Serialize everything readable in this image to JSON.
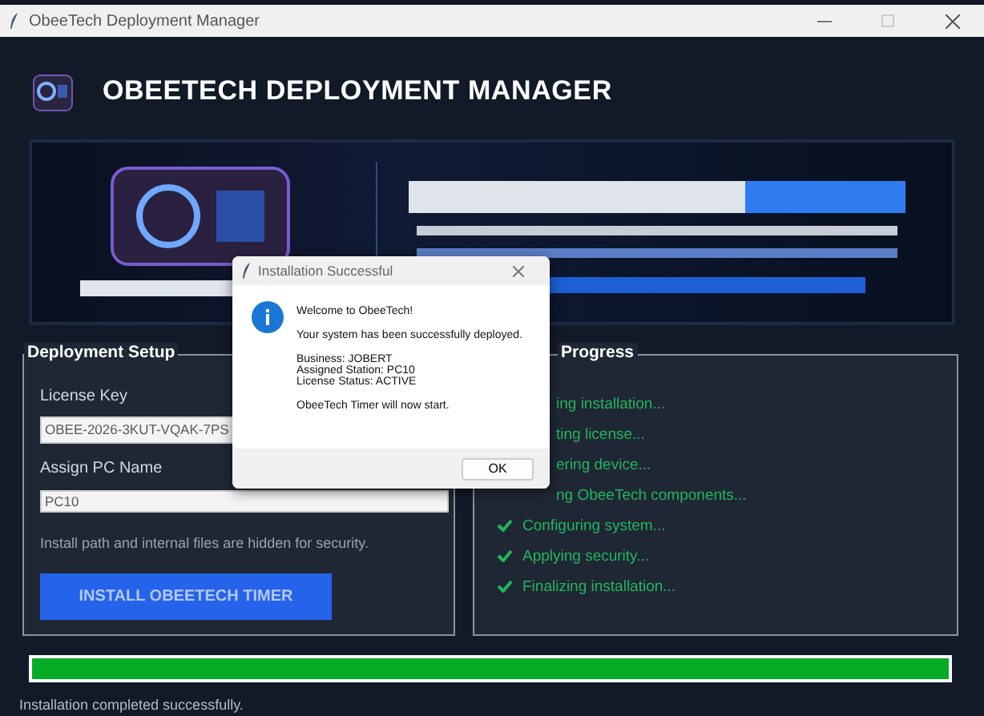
{
  "window": {
    "title": "ObeeTech Deployment Manager"
  },
  "header": {
    "title": "OBEETECH DEPLOYMENT MANAGER"
  },
  "setup": {
    "title": "Deployment Setup",
    "fields": [
      {
        "label": "License Key",
        "value": "OBEE-2026-3KUT-VQAK-7PS"
      },
      {
        "label": "Assign PC Name",
        "value": "PC10"
      }
    ],
    "note": "Install path and internal files are hidden for security.",
    "button": {
      "label": "INSTALL OBEETECH TIMER",
      "disabled": true
    }
  },
  "progress": {
    "title": "Progress",
    "steps": [
      {
        "text": "ing installation...",
        "kind": "covered"
      },
      {
        "text": "ting license...",
        "kind": "covered"
      },
      {
        "text": "ering device...",
        "kind": "covered"
      },
      {
        "text": "ng ObeeTech components...",
        "kind": "covered"
      },
      {
        "text": "Configuring system...",
        "kind": "done"
      },
      {
        "text": "Applying security...",
        "kind": "done"
      },
      {
        "text": "Finalizing installation...",
        "kind": "done"
      }
    ]
  },
  "progress_bar": {
    "level": 1
  },
  "status_bar": "Installation completed successfully.",
  "dialog": {
    "title": "Installation Successful",
    "heading": "Welcome to ObeeTech!",
    "message": "Your system has been successfully deployed.",
    "details": [
      "Business: JOBERT",
      "Assigned Station: PC10",
      "License Status: ACTIVE"
    ],
    "footer": "ObeeTech Timer will now start.",
    "button": "OK"
  }
}
